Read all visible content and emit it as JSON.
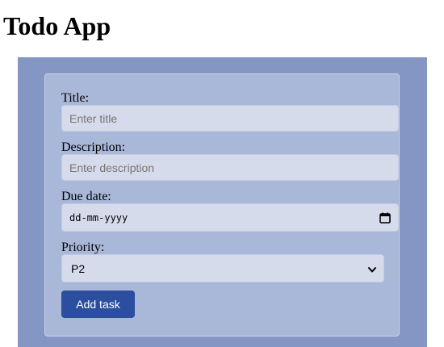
{
  "page": {
    "title": "Todo App"
  },
  "form": {
    "title_label": "Title:",
    "title_placeholder": "Enter title",
    "title_value": "",
    "description_label": "Description:",
    "description_placeholder": "Enter description",
    "description_value": "",
    "due_date_label": "Due date:",
    "due_date_placeholder": "dd-mm-yyyy",
    "priority_label": "Priority:",
    "priority_selected": "P2",
    "submit_label": "Add task"
  },
  "icons": {
    "due_date": "calendar-icon",
    "priority": "chevron-down-icon"
  },
  "colors": {
    "outer_panel": "#8396c4",
    "card": "#a9b7d8",
    "input_bg": "#d6dbec",
    "button": "#2b4f9e"
  }
}
